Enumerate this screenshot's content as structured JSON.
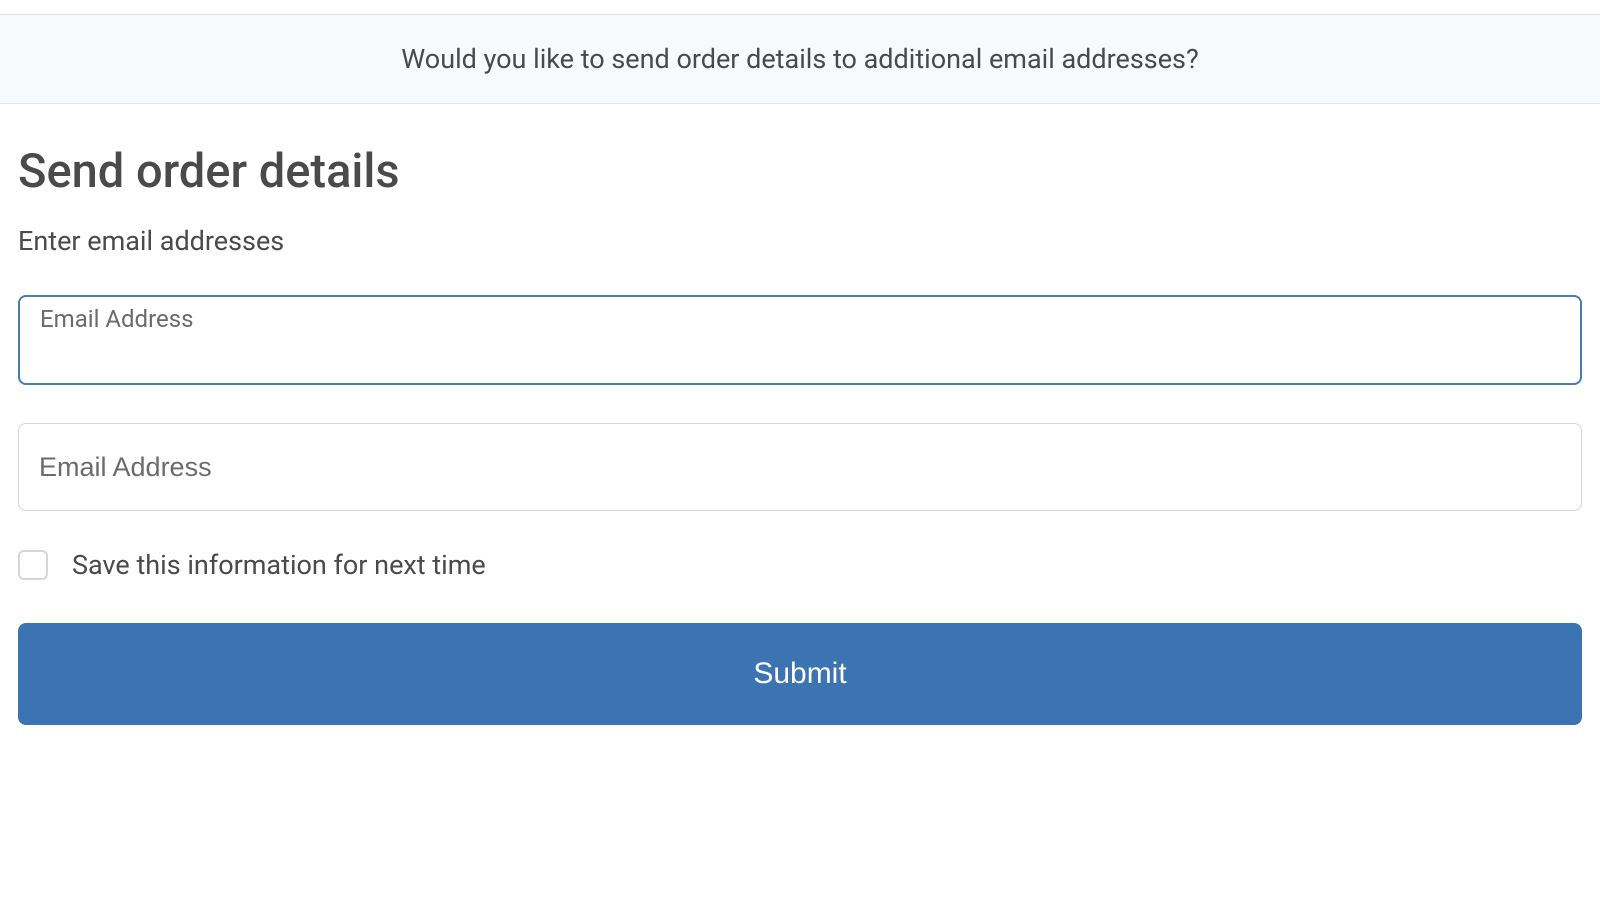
{
  "banner": {
    "message": "Would you like to send order details to additional email addresses?"
  },
  "main": {
    "title": "Send order details",
    "subtitle": "Enter email addresses",
    "inputs": {
      "email1_label": "Email Address",
      "email1_value": "",
      "email2_placeholder": "Email Address",
      "email2_value": ""
    },
    "save_checkbox_label": "Save this information for next time",
    "save_checkbox_checked": false,
    "submit_label": "Submit"
  }
}
